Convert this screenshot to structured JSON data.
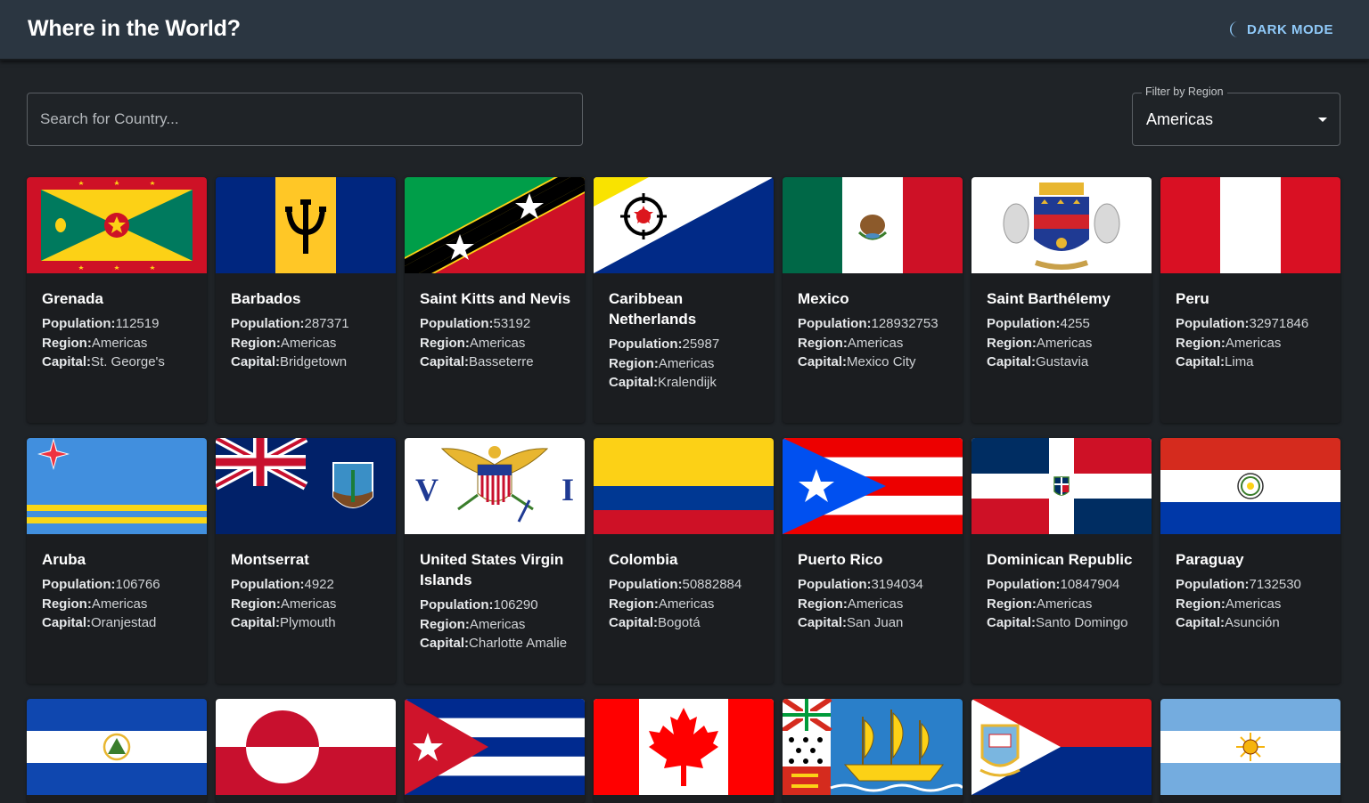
{
  "header": {
    "title": "Where in the World?",
    "mode_label": "DARK MODE",
    "mode_icon": "moon-icon"
  },
  "search": {
    "placeholder": "Search for Country...",
    "value": ""
  },
  "filter": {
    "label": "Filter by Region",
    "value": "Americas"
  },
  "labels": {
    "population": "Population:",
    "region": "Region:",
    "capital": "Capital:"
  },
  "countries": [
    {
      "name": "Grenada",
      "population": "112519",
      "region": "Americas",
      "capital": "St. George's"
    },
    {
      "name": "Barbados",
      "population": "287371",
      "region": "Americas",
      "capital": "Bridgetown"
    },
    {
      "name": "Saint Kitts and Nevis",
      "population": "53192",
      "region": "Americas",
      "capital": "Basseterre"
    },
    {
      "name": "Caribbean Netherlands",
      "population": "25987",
      "region": "Americas",
      "capital": "Kralendijk"
    },
    {
      "name": "Mexico",
      "population": "128932753",
      "region": "Americas",
      "capital": "Mexico City"
    },
    {
      "name": "Saint Barthélemy",
      "population": "4255",
      "region": "Americas",
      "capital": "Gustavia"
    },
    {
      "name": "Peru",
      "population": "32971846",
      "region": "Americas",
      "capital": "Lima"
    },
    {
      "name": "Aruba",
      "population": "106766",
      "region": "Americas",
      "capital": "Oranjestad"
    },
    {
      "name": "Montserrat",
      "population": "4922",
      "region": "Americas",
      "capital": "Plymouth"
    },
    {
      "name": "United States Virgin Islands",
      "population": "106290",
      "region": "Americas",
      "capital": "Charlotte Amalie"
    },
    {
      "name": "Colombia",
      "population": "50882884",
      "region": "Americas",
      "capital": "Bogotá"
    },
    {
      "name": "Puerto Rico",
      "population": "3194034",
      "region": "Americas",
      "capital": "San Juan"
    },
    {
      "name": "Dominican Republic",
      "population": "10847904",
      "region": "Americas",
      "capital": "Santo Domingo"
    },
    {
      "name": "Paraguay",
      "population": "7132530",
      "region": "Americas",
      "capital": "Asunción"
    }
  ],
  "flag_only_cards": [
    {
      "flag": "el-salvador-flag"
    },
    {
      "flag": "greenland-flag"
    },
    {
      "flag": "cuba-flag"
    },
    {
      "flag": "canada-flag"
    },
    {
      "flag": "saint-pierre-and-miquelon-flag"
    },
    {
      "flag": "sint-maarten-flag"
    },
    {
      "flag": "argentina-flag"
    }
  ],
  "colors": {
    "header_bg": "#2b3641",
    "page_bg": "#1f2327",
    "card_bg": "#1b1d20",
    "accent": "#90caf9"
  }
}
